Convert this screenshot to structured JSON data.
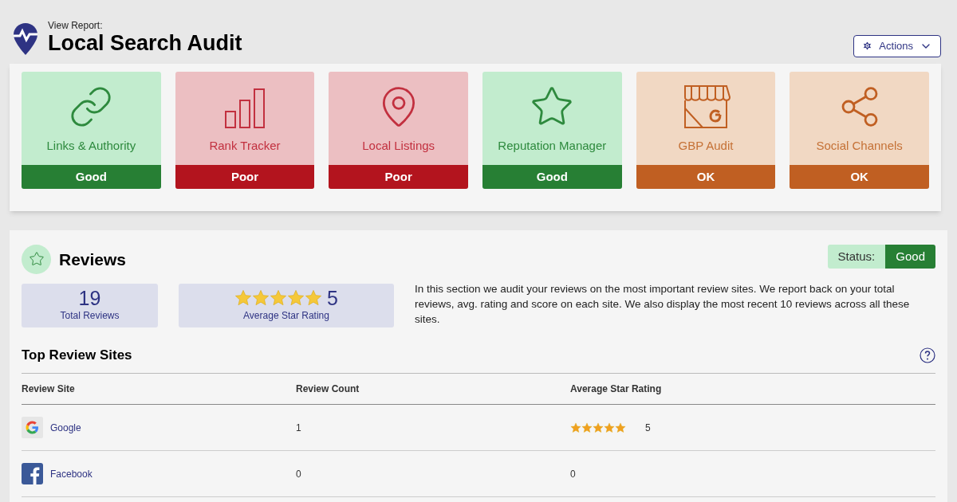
{
  "header": {
    "eyebrow": "View Report:",
    "title": "Local Search Audit",
    "actions_button": "Actions"
  },
  "audit_cards": [
    {
      "kind": "link",
      "label": "Links & Authority",
      "status": "Good",
      "color": "#277f34"
    },
    {
      "kind": "bars",
      "label": "Rank Tracker",
      "status": "Poor",
      "color": "#b3141e"
    },
    {
      "kind": "pin",
      "label": "Local Listings",
      "status": "Poor",
      "color": "#b3141e"
    },
    {
      "kind": "star",
      "label": "Reputation Manager",
      "status": "Good",
      "color": "#277f34"
    },
    {
      "kind": "store",
      "label": "GBP Audit",
      "status": "OK",
      "color": "#c05f22"
    },
    {
      "kind": "share",
      "label": "Social Channels",
      "status": "OK",
      "color": "#c05f22"
    }
  ],
  "reviews": {
    "title": "Reviews",
    "status_label": "Status:",
    "status_value": "Good",
    "total": {
      "value": "19",
      "label": "Total Reviews"
    },
    "average": {
      "stars": 5,
      "value": "5",
      "label": "Average Star Rating"
    },
    "description": "In this section we audit your reviews on the most important review sites. We report back on your total reviews, avg. rating and score on each site. We also display the most recent 10 reviews across all these sites.",
    "table": {
      "title": "Top Review Sites",
      "columns": [
        "Review Site",
        "Review Count",
        "Average Star Rating"
      ],
      "rows": [
        {
          "kind": "google",
          "site": "Google",
          "count": "1",
          "stars": 5,
          "rating": "5"
        },
        {
          "kind": "facebook",
          "site": "Facebook",
          "count": "0",
          "rating": "0"
        }
      ]
    }
  }
}
